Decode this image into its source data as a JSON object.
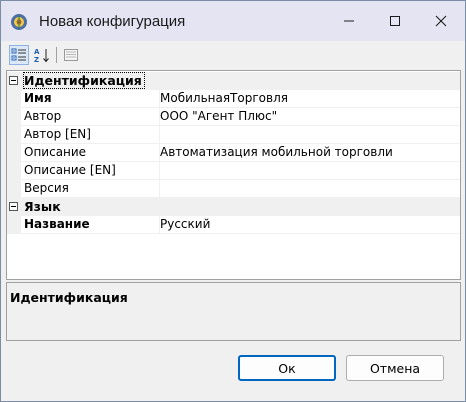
{
  "window": {
    "title": "Новая конфигурация"
  },
  "toolbar": {
    "buttons": [
      {
        "name": "categorized-view-icon",
        "selected": true
      },
      {
        "name": "alphabetical-sort-icon",
        "selected": false
      },
      {
        "name": "property-pages-icon",
        "selected": false
      }
    ]
  },
  "property_grid": {
    "categories": [
      {
        "label": "Идентификация",
        "properties": [
          {
            "name": "Имя",
            "value": "МобильнаяТорговля",
            "bold": true
          },
          {
            "name": "Автор",
            "value": "ООО \"Агент Плюс\""
          },
          {
            "name": "Автор [EN]",
            "value": ""
          },
          {
            "name": "Описание",
            "value": "Автоматизация мобильной торговли"
          },
          {
            "name": "Описание [EN]",
            "value": ""
          },
          {
            "name": "Версия",
            "value": ""
          }
        ]
      },
      {
        "label": "Язык",
        "properties": [
          {
            "name": "Название",
            "value": "Русский",
            "bold": true
          }
        ]
      }
    ]
  },
  "description": {
    "title": "Идентификация"
  },
  "buttons": {
    "ok": "Ок",
    "cancel": "Отмена"
  },
  "colors": {
    "titlebar": "#e5e4f3",
    "default_button_border": "#0067c0",
    "category_background": "#f0f0f0"
  }
}
